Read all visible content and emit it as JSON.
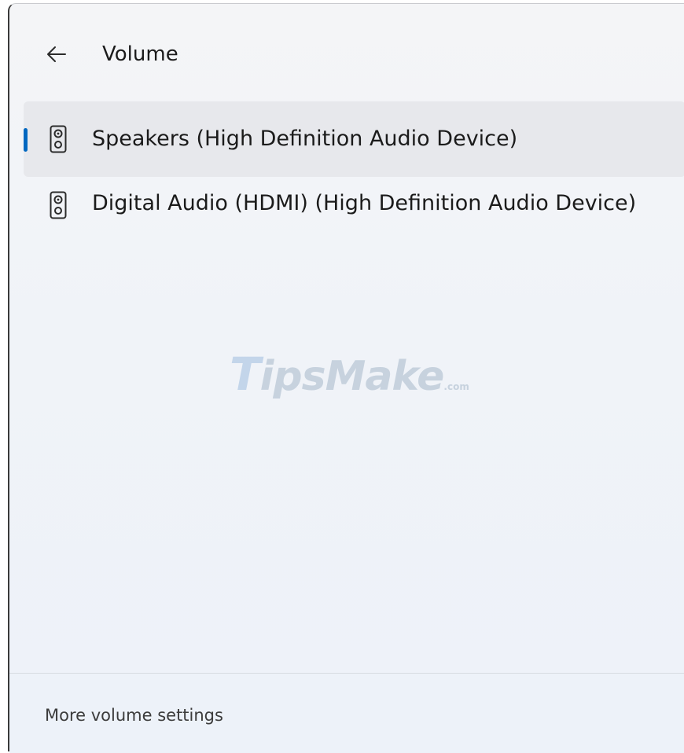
{
  "header": {
    "back_icon": "arrow-left-icon",
    "title": "Volume"
  },
  "devices": [
    {
      "label": "Speakers (High Definition Audio Device)",
      "icon": "speaker-icon",
      "selected": true
    },
    {
      "label": "Digital Audio (HDMI) (High Definition Audio Device)",
      "icon": "speaker-icon",
      "selected": false
    }
  ],
  "watermark": {
    "first": "T",
    "rest": "ipsMake",
    "suffix": ".com"
  },
  "footer": {
    "more_settings_label": "More volume settings"
  },
  "colors": {
    "accent": "#0067c0",
    "selected_background": "#e7e8ec",
    "text": "#1b1b1b"
  }
}
